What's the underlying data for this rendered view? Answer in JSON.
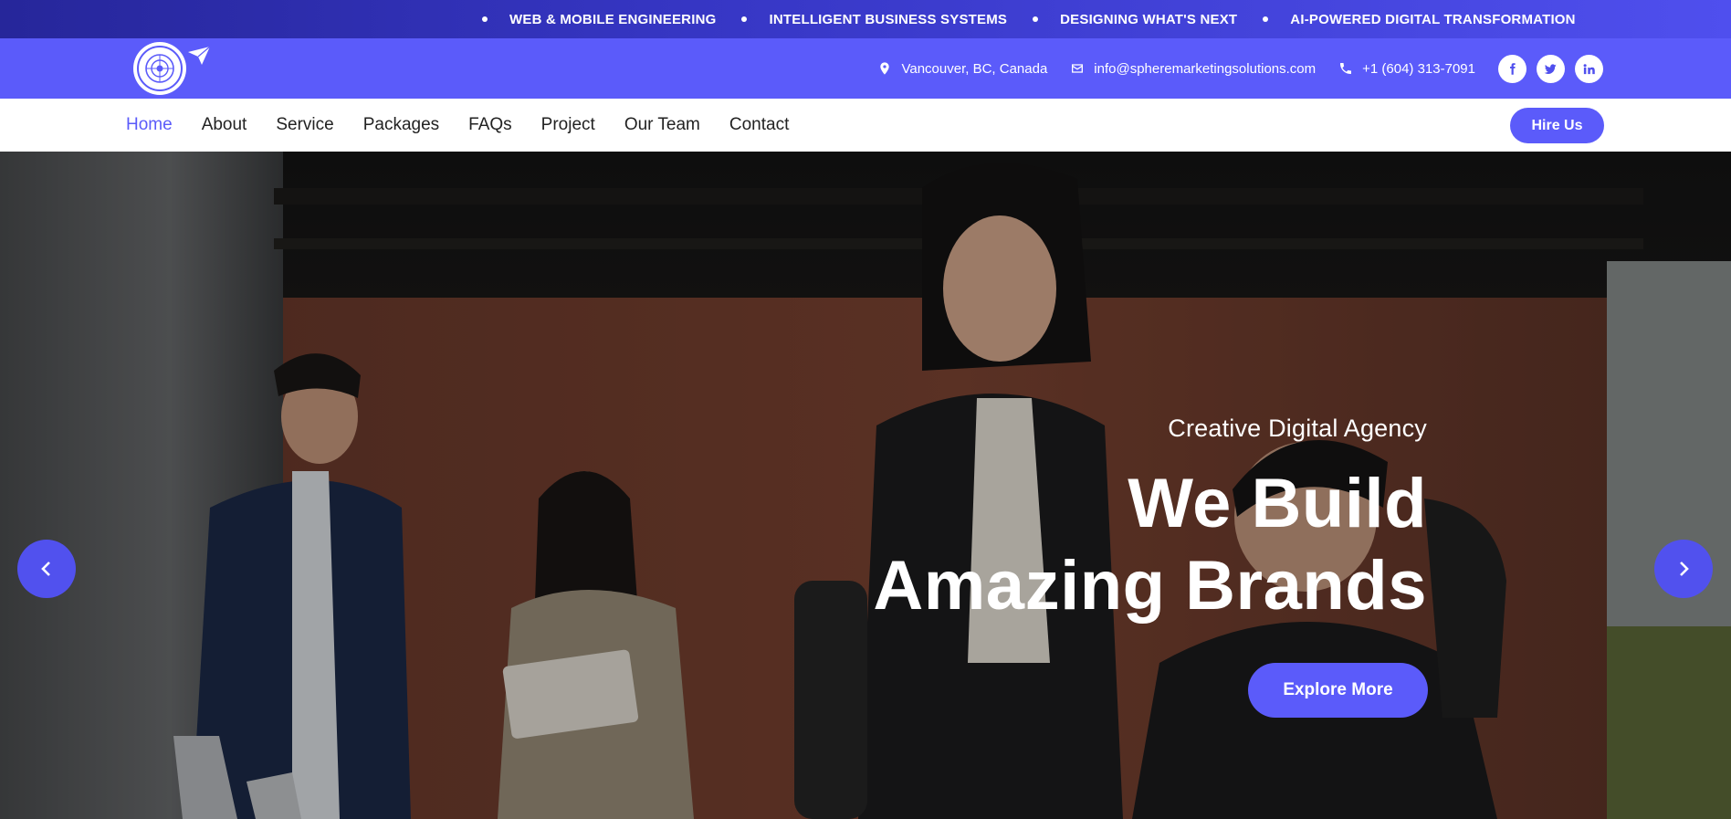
{
  "ticker": {
    "items": [
      "WEB & MOBILE ENGINEERING",
      "INTELLIGENT BUSINESS SYSTEMS",
      "DESIGNING WHAT'S NEXT",
      "AI-POWERED DIGITAL TRANSFORMATION"
    ]
  },
  "contact": {
    "location": "Vancouver, BC, Canada",
    "email": "info@spheremarketingsolutions.com",
    "phone": "+1 (604) 313-7091",
    "socials": [
      "facebook-icon",
      "twitter-icon",
      "linkedin-icon"
    ]
  },
  "nav": {
    "items": [
      "Home",
      "About",
      "Service",
      "Packages",
      "FAQs",
      "Project",
      "Our Team",
      "Contact"
    ],
    "active": "Home",
    "hire_label": "Hire Us"
  },
  "hero": {
    "subtitle": "Creative Digital Agency",
    "title_line1": "We Build",
    "title_line2": "Amazing Brands",
    "cta_label": "Explore More"
  },
  "colors": {
    "brand": "#5b5bfa",
    "ticker_dark": "#26269a",
    "text_dark": "#222222",
    "white": "#ffffff"
  }
}
